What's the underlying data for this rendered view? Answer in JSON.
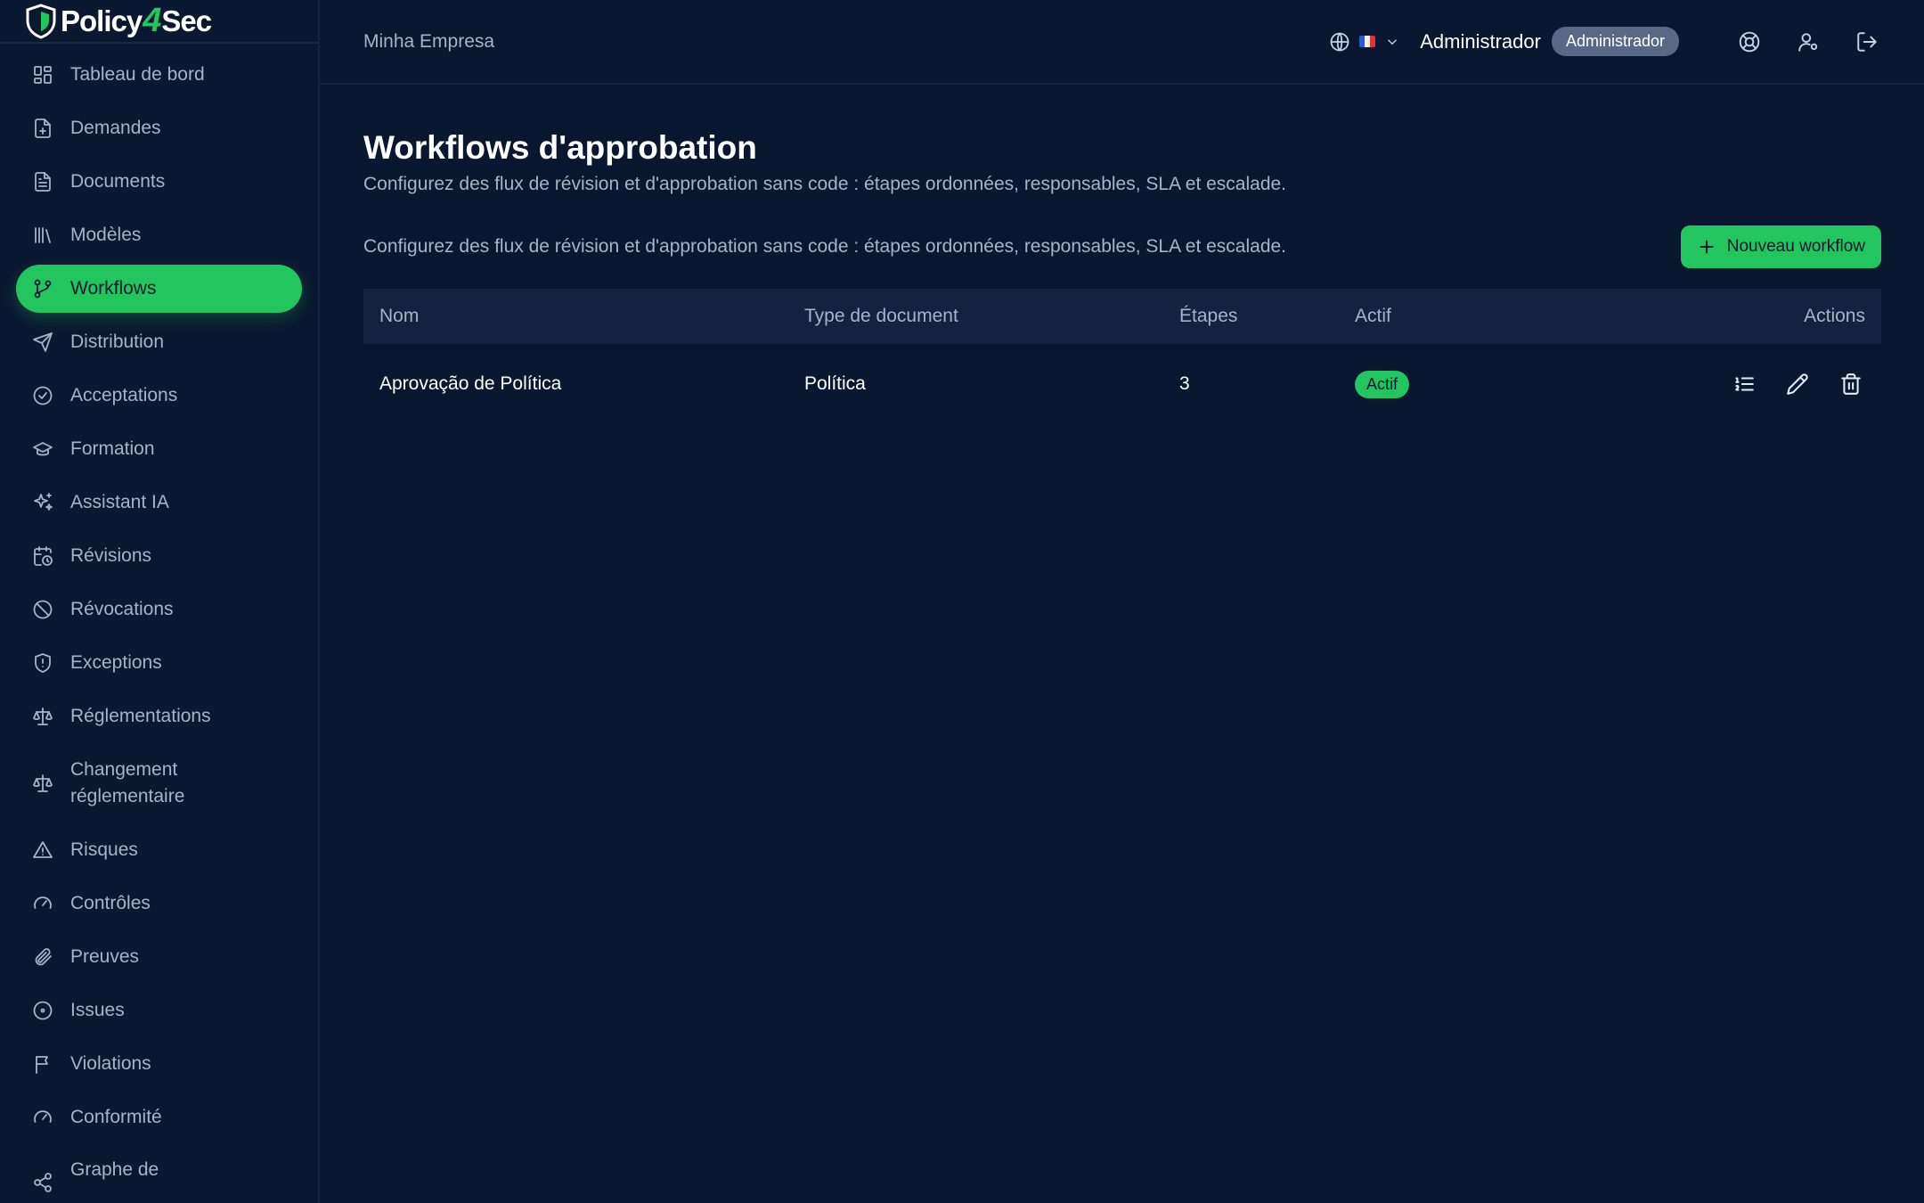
{
  "brand": {
    "name_left": "Policy",
    "name_mid": "4",
    "name_right": "Sec"
  },
  "sidebar": {
    "items": [
      {
        "label": "Tableau de bord",
        "icon": "dashboard-icon"
      },
      {
        "label": "Demandes",
        "icon": "file-plus-icon"
      },
      {
        "label": "Documents",
        "icon": "document-icon"
      },
      {
        "label": "Modèles",
        "icon": "library-icon"
      },
      {
        "label": "Workflows",
        "icon": "git-branch-icon",
        "active": true
      },
      {
        "label": "Distribution",
        "icon": "send-icon"
      },
      {
        "label": "Acceptations",
        "icon": "check-circle-icon"
      },
      {
        "label": "Formation",
        "icon": "graduation-cap-icon"
      },
      {
        "label": "Assistant IA",
        "icon": "sparkles-icon"
      },
      {
        "label": "Révisions",
        "icon": "calendar-clock-icon"
      },
      {
        "label": "Révocations",
        "icon": "ban-icon"
      },
      {
        "label": "Exceptions",
        "icon": "shield-alert-icon"
      },
      {
        "label": "Réglementations",
        "icon": "scale-icon"
      },
      {
        "label": "Changement réglementaire",
        "icon": "scale-icon"
      },
      {
        "label": "Risques",
        "icon": "warning-triangle-icon"
      },
      {
        "label": "Contrôles",
        "icon": "gauge-icon"
      },
      {
        "label": "Preuves",
        "icon": "paperclip-icon"
      },
      {
        "label": "Issues",
        "icon": "circle-dot-icon"
      },
      {
        "label": "Violations",
        "icon": "flag-icon"
      },
      {
        "label": "Conformité",
        "icon": "gauge-icon"
      },
      {
        "label": "Graphe de",
        "icon": "share-icon"
      }
    ]
  },
  "header": {
    "company": "Minha Empresa",
    "user_name": "Administrador",
    "role": "Administrador"
  },
  "page": {
    "title": "Workflows d'approbation",
    "subtitle": "Configurez des flux de révision et d'approbation sans code : étapes ordonnées, responsables, SLA et escalade.",
    "toolbar_desc": "Configurez des flux de révision et d'approbation sans code : étapes ordonnées, responsables, SLA et escalade.",
    "new_button": "Nouveau workflow"
  },
  "table": {
    "columns": [
      "Nom",
      "Type de document",
      "Étapes",
      "Actif",
      "Actions"
    ],
    "rows": [
      {
        "name": "Aprovação de Política",
        "doc_type": "Política",
        "steps": "3",
        "status": "Actif"
      }
    ]
  },
  "colors": {
    "accent": "#22c55e",
    "background": "#0a1730",
    "sidebar": "#0b1831"
  }
}
